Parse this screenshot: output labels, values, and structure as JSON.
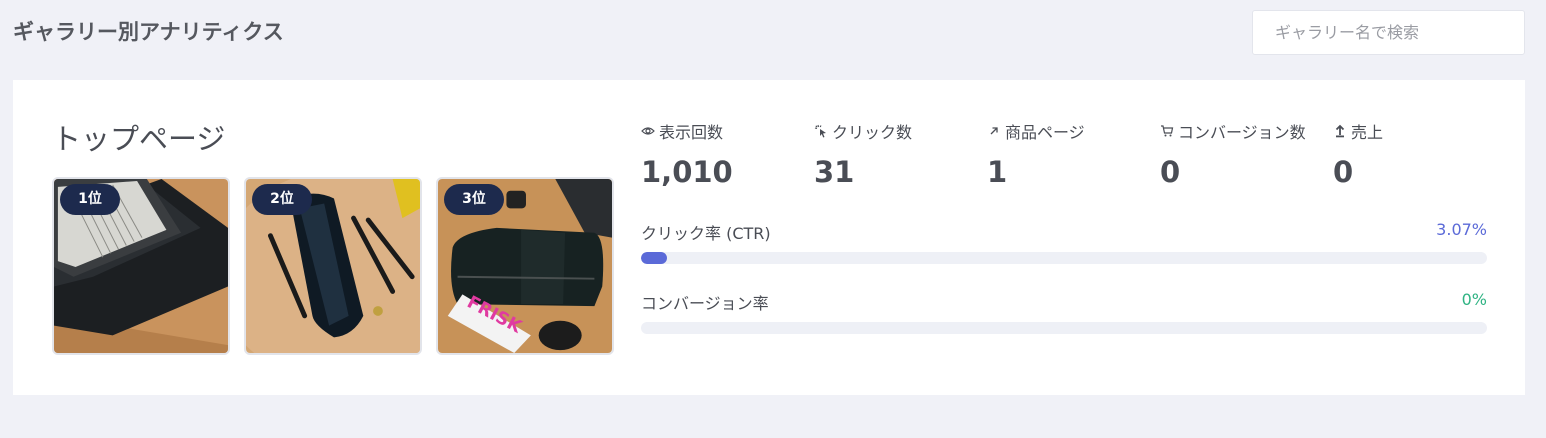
{
  "page": {
    "title": "ギャラリー別アナリティクス"
  },
  "search": {
    "placeholder": "ギャラリー名で検索"
  },
  "gallery": {
    "name": "トップページ",
    "top_items": [
      {
        "rank_label": "1位",
        "image": "tablet-case-photo"
      },
      {
        "rank_label": "2位",
        "image": "pen-case-photo"
      },
      {
        "rank_label": "3位",
        "image": "pouch-photo"
      }
    ],
    "stats": [
      {
        "icon": "eye-icon",
        "label": "表示回数",
        "value": "1,010"
      },
      {
        "icon": "cursor-click-icon",
        "label": "クリック数",
        "value": "31"
      },
      {
        "icon": "arrow-up-right-icon",
        "label": "商品ページ",
        "value": "1"
      },
      {
        "icon": "cart-icon",
        "label": "コンバージョン数",
        "value": "0"
      },
      {
        "icon": "upload-icon",
        "label": "売上",
        "value": "0"
      }
    ],
    "ctr": {
      "label": "クリック率 (CTR)",
      "value_text": "3.07%",
      "value": 3.07,
      "color": "#5b6ad8"
    },
    "conversion_rate": {
      "label": "コンバージョン率",
      "value_text": "0%",
      "value": 0,
      "color": "#2fb383"
    }
  },
  "colors": {
    "background": "#f0f1f7",
    "badge": "#1d2a4d",
    "accent": "#5b6ad8",
    "success": "#2fb383"
  }
}
